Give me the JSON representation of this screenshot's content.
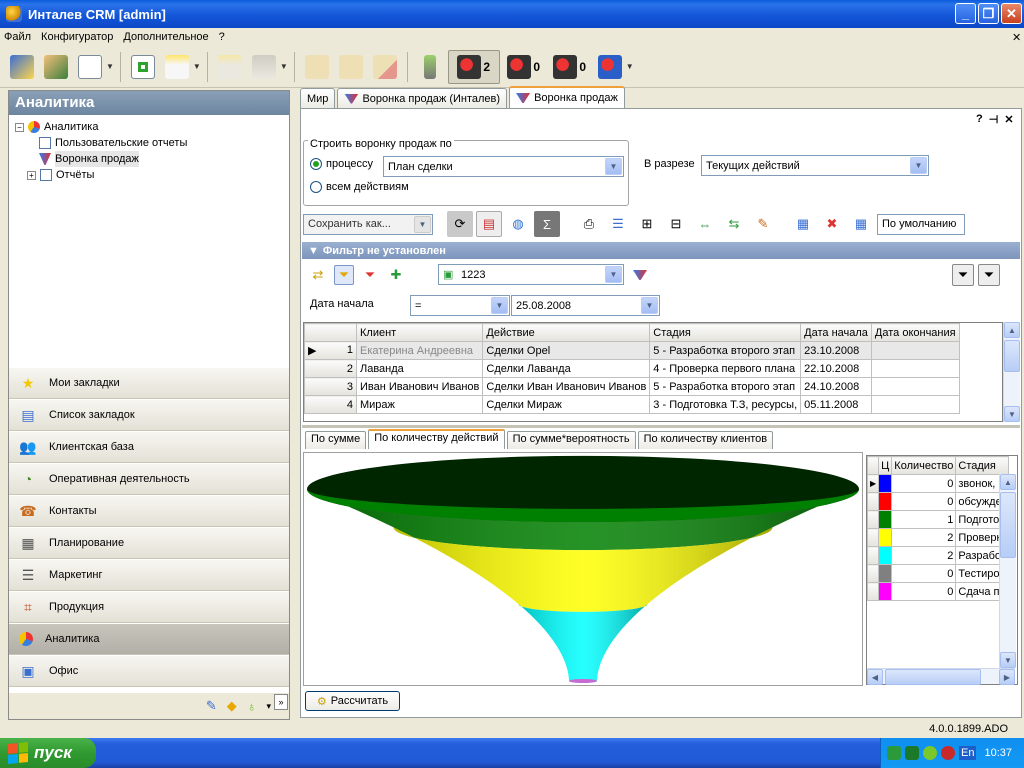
{
  "window": {
    "title": "Инталев CRM [admin]"
  },
  "menu": [
    "Файл",
    "Конфигуратор",
    "Дополнительное",
    "?"
  ],
  "toolbar": {
    "count_1": "2",
    "count_2": "0",
    "count_3": "0"
  },
  "left_panel": {
    "title": "Аналитика",
    "tree": [
      {
        "label": "Аналитика"
      },
      {
        "label": "Пользовательские отчеты"
      },
      {
        "label": "Воронка продаж"
      },
      {
        "label": "Отчёты"
      }
    ],
    "nav": [
      {
        "label": "Мои закладки",
        "icon": "star-icon"
      },
      {
        "label": "Список закладок",
        "icon": "bookmark-list-icon"
      },
      {
        "label": "Клиентская база",
        "icon": "clients-icon"
      },
      {
        "label": "Оперативная деятельность",
        "icon": "operations-icon"
      },
      {
        "label": "Контакты",
        "icon": "contacts-icon"
      },
      {
        "label": "Планирование",
        "icon": "calendar-icon"
      },
      {
        "label": "Маркетинг",
        "icon": "marketing-icon"
      },
      {
        "label": "Продукция",
        "icon": "products-icon"
      },
      {
        "label": "Аналитика",
        "icon": "analytics-icon"
      },
      {
        "label": "Офис",
        "icon": "office-icon"
      }
    ]
  },
  "tabs": [
    "Мир",
    "Воронка продаж (Инталев)",
    "Воронка продаж"
  ],
  "builder": {
    "legend": "Строить воронку продаж по",
    "opt_process": "процессу",
    "opt_all": "всем действиям",
    "process_value": "План сделки",
    "slice_label": "В разрезе",
    "slice_value": "Текущих действий"
  },
  "toolbar2": {
    "save_as": "Сохранить как...",
    "layout_value": "По умолчанию"
  },
  "filter": {
    "header": "Фильтр не установлен",
    "combo_value": "1223",
    "field_label": "Дата начала",
    "operator": "=",
    "date_value": "25.08.2008"
  },
  "grid": {
    "headers": [
      "Клиент",
      "Действие",
      "Стадия",
      "Дата начала",
      "Дата окончания"
    ],
    "rows": [
      {
        "n": "1",
        "client": "Екатерина Андреевна",
        "action": "Сделки Opel",
        "stage": "5 - Разработка второго этап",
        "start": "23.10.2008",
        "end": ""
      },
      {
        "n": "2",
        "client": "Лаванда",
        "action": "Сделки Лаванда",
        "stage": "4 - Проверка первого плана",
        "start": "22.10.2008",
        "end": ""
      },
      {
        "n": "3",
        "client": "Иван Иванович Иванов",
        "action": "Сделки Иван Иванович Иванов",
        "stage": "5 - Разработка второго этап",
        "start": "24.10.2008",
        "end": ""
      },
      {
        "n": "4",
        "client": "Мираж",
        "action": "Сделки Мираж",
        "stage": "3 - Подготовка Т.З, ресурсы,",
        "start": "05.11.2008",
        "end": ""
      }
    ]
  },
  "chart_tabs": [
    "По сумме",
    "По количеству действий",
    "По сумме*вероятность",
    "По количеству клиентов"
  ],
  "chart_data": {
    "type": "funnel",
    "stages": [
      {
        "color": "#0000ff",
        "count": 0,
        "name": "звонок,"
      },
      {
        "color": "#ff0000",
        "count": 0,
        "name": "обсужде"
      },
      {
        "color": "#008000",
        "count": 1,
        "name": "Подгото"
      },
      {
        "color": "#ffff00",
        "count": 2,
        "name": "Проверк"
      },
      {
        "color": "#00ffff",
        "count": 2,
        "name": "Разрабо"
      },
      {
        "color": "#808080",
        "count": 0,
        "name": "Тестиро"
      },
      {
        "color": "#ff00ff",
        "count": 0,
        "name": "Сдача пр"
      }
    ],
    "legend_headers": [
      "Ц",
      "Количество",
      "Стадия"
    ]
  },
  "calc_button": "Рассчитать",
  "status": {
    "version": "4.0.0.1899.ADO"
  },
  "taskbar": {
    "start": "пуск",
    "lang": "En",
    "clock": "10:37"
  }
}
